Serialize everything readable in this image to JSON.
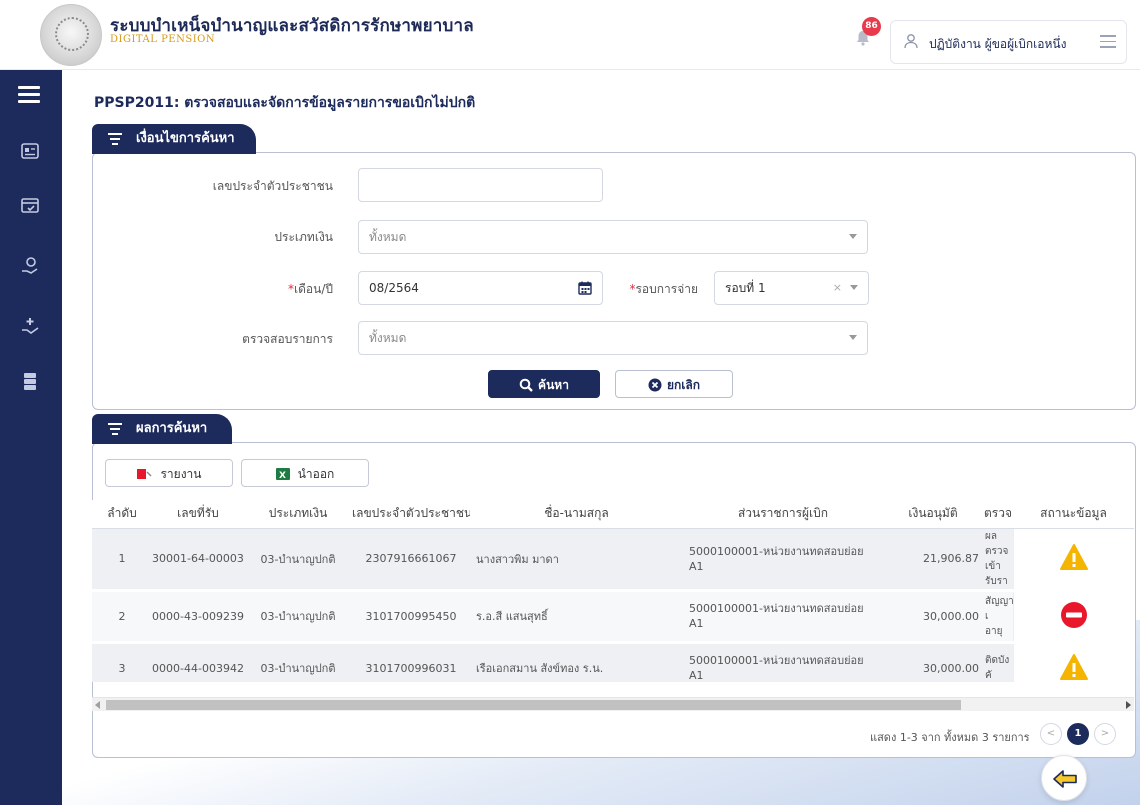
{
  "header": {
    "app_title": "ระบบบำเหน็จบำนาญและสวัสดิการรักษาพยาบาล",
    "app_subtitle": "DIGITAL PENSION",
    "notification_count": "86",
    "user_name": "ปฏิบัติงาน ผู้ขอผู้เบิกเอหนึ่ง"
  },
  "sidebar": {
    "icons": [
      "menu-icon",
      "id-card-icon",
      "payment-check-icon",
      "pension-hand-icon",
      "medical-hand-icon",
      "server-list-icon"
    ]
  },
  "page": {
    "title": "PPSP2011:  ตรวจสอบและจัดการข้อมูลรายการขอเบิกไม่ปกติ"
  },
  "search": {
    "tab_label": "เงื่อนไขการค้นหา",
    "id_label": "เลขประจำตัวประชาชน",
    "id_value": "",
    "money_type_label": "ประเภทเงิน",
    "money_type_value": "ทั้งหมด",
    "month_label_req": "*",
    "month_label": "เดือน/ปี",
    "month_value": "08/2564",
    "round_label_req": "*",
    "round_label": "รอบการจ่าย",
    "round_value": "รอบที่ 1",
    "check_label": "ตรวจสอบรายการ",
    "check_value": "ทั้งหมด",
    "search_button": "ค้นหา",
    "cancel_button": "ยกเลิก"
  },
  "results": {
    "tab_label": "ผลการค้นหา",
    "report_button": "รายงาน",
    "export_button": "นำออก",
    "columns": [
      "ลำดับ",
      "เลขที่รับ",
      "ประเภทเงิน",
      "เลขประจำตัวประชาชน",
      "ชื่อ-นามสกุล",
      "ส่วนราชการผู้เบิก",
      "เงินอนุมัติ",
      "ตรวจ",
      "สถานะข้อมูล"
    ],
    "rows": [
      {
        "no": "1",
        "receipt": "30001-64-000032",
        "money_type": "03-บำนาญปกติ",
        "citizen_id": "2307916661067",
        "name": "นางสาวพิม มาดา",
        "agency_line1": "5000100001-หน่วยงานทดสอบย่อย",
        "agency_line2": "A1",
        "amount": "21,906.87",
        "check_line1": "ผลตรวจ",
        "check_line2": "เข้ารับรา",
        "status": "warning",
        "status_color": "#f5b400"
      },
      {
        "no": "2",
        "receipt": "0000-43-009239",
        "money_type": "03-บำนาญปกติ",
        "citizen_id": "3101700995450",
        "name": "ร.อ.สี แสนสุทธิ์",
        "agency_line1": "5000100001-หน่วยงานทดสอบย่อย",
        "agency_line2": "A1",
        "amount": "30,000.00",
        "check_line1": "สัญญาเ",
        "check_line2": "อายุ",
        "status": "error",
        "status_color": "#e8172c"
      },
      {
        "no": "3",
        "receipt": "0000-44-003942",
        "money_type": "03-บำนาญปกติ",
        "citizen_id": "3101700996031",
        "name": "เรือเอกสมาน สังข์ทอง ร.น.",
        "agency_line1": "5000100001-หน่วยงานทดสอบย่อย",
        "agency_line2": "A1",
        "amount": "30,000.00",
        "check_line1": "ติดบังคั",
        "check_line2": "",
        "status": "warning",
        "status_color": "#f5b400"
      }
    ],
    "pager_text": "แสดง 1-3 จาก ทั้งหมด 3 รายการ",
    "pager_prev": "<",
    "pager_page": "1",
    "pager_next": ">"
  },
  "colors": {
    "navy": "#1c2a5c",
    "accent_gold": "#d69a1c",
    "badge_red": "#e83a4b"
  }
}
